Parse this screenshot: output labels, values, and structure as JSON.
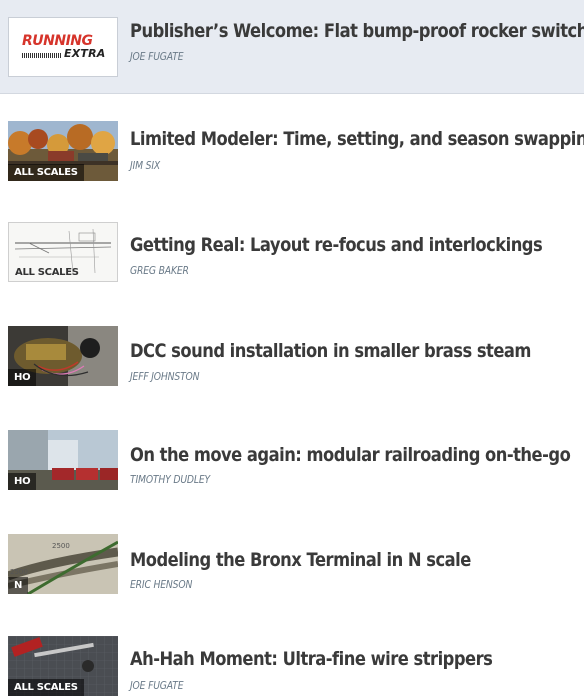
{
  "articles": [
    {
      "title": "Publisher’s Welcome: Flat bump-proof rocker switches",
      "author": "JOE FUGATE",
      "thumb": "running-extra-logo",
      "logo_line1": "RUNNING",
      "logo_line2": "EXTRA",
      "scale": ""
    },
    {
      "title": "Limited Modeler: Time, setting, and season swapping",
      "author": "JIM SIX",
      "thumb": "autumn-layout-photo",
      "scale": "ALL SCALES"
    },
    {
      "title": "Getting Real: Layout re-focus and interlockings",
      "author": "GREG BAKER",
      "thumb": "track-plan-drawing",
      "scale": "ALL SCALES"
    },
    {
      "title": "DCC sound installation in smaller brass steam",
      "author": "JEFF JOHNSTON",
      "thumb": "brass-steam-decoder-photo",
      "scale": "HO"
    },
    {
      "title": "On the move again: modular railroading on-the-go",
      "author": "TIMOTHY DUDLEY",
      "thumb": "modular-boxcars-photo",
      "scale": "HO"
    },
    {
      "title": "Modeling the Bronx Terminal in N scale",
      "author": "ERIC HENSON",
      "thumb": "bronx-terminal-photo",
      "scale": "N",
      "thumb_labels": [
        "2500",
        "2500"
      ]
    },
    {
      "title": "Ah-Hah Moment: Ultra-fine wire strippers",
      "author": "JOE FUGATE",
      "thumb": "wire-strippers-photo",
      "scale": "ALL SCALES"
    }
  ],
  "colors": {
    "featured_bg": "#e7ebf2",
    "title": "#3a3a3a",
    "author": "#6a7a88",
    "logo_red": "#d6342b"
  }
}
